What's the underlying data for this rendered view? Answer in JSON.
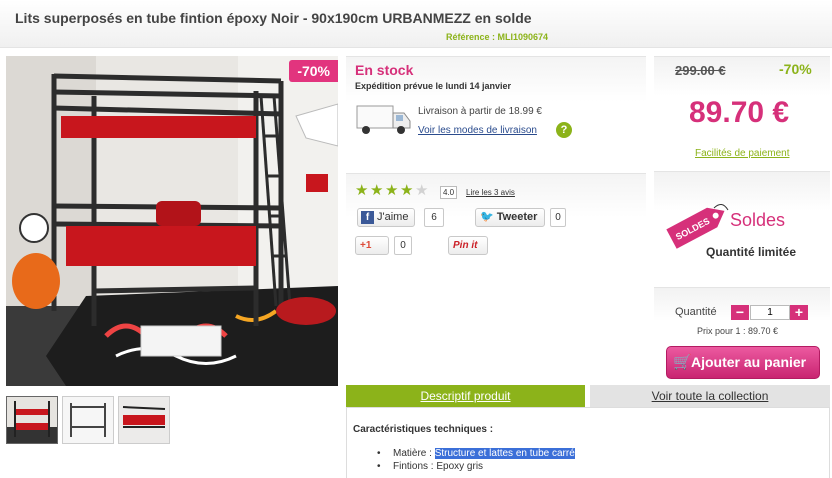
{
  "header": {
    "title": "Lits superposés en tube fintion époxy Noir - 90x190cm URBANMEZZ en solde",
    "reference": "Référence : MLI1090674"
  },
  "gallery": {
    "discount_badge": "-70%",
    "thumbnail_count": 3
  },
  "stock": {
    "status": "En stock",
    "shipping_date": "Expédition prévue le lundi 14 janvier",
    "delivery_price": "Livraison à partir de 18.99 €",
    "delivery_link": "Voir les modes de livraison",
    "help_icon": "?"
  },
  "social": {
    "rating": 4.0,
    "rating_label": "4.0",
    "reviews_link": "Lire les 3 avis",
    "fb_label": "J'aime",
    "fb_count": "6",
    "tweet_label": "Tweeter",
    "tweet_count": "0",
    "gplus_label": "+1",
    "gplus_count": "0",
    "pin_label": "Pin it"
  },
  "price": {
    "old": "299.00 €",
    "discount": "-70%",
    "current": "89.70 €",
    "payment_link": "Facilités de paiement"
  },
  "soldes": {
    "tag_text": "SOLDES",
    "title": "Soldes",
    "limited": "Quantité limitée"
  },
  "cart": {
    "qty_label": "Quantité",
    "minus": "−",
    "plus": "+",
    "qty_value": "1",
    "unit_price": "Prix pour 1 : 89.70 €",
    "add_button": "Ajouter au panier"
  },
  "tabs": {
    "description": "Descriptif produit",
    "collection": "Voir toute la collection"
  },
  "description": {
    "heading": "Caractéristiques techniques :",
    "material_label": "Matière : ",
    "material_value": "Structure et lattes en tube carré",
    "finish": "Fintions : Epoxy gris"
  },
  "colors": {
    "brand_pink": "#d6307a",
    "brand_green": "#8cb31a"
  }
}
